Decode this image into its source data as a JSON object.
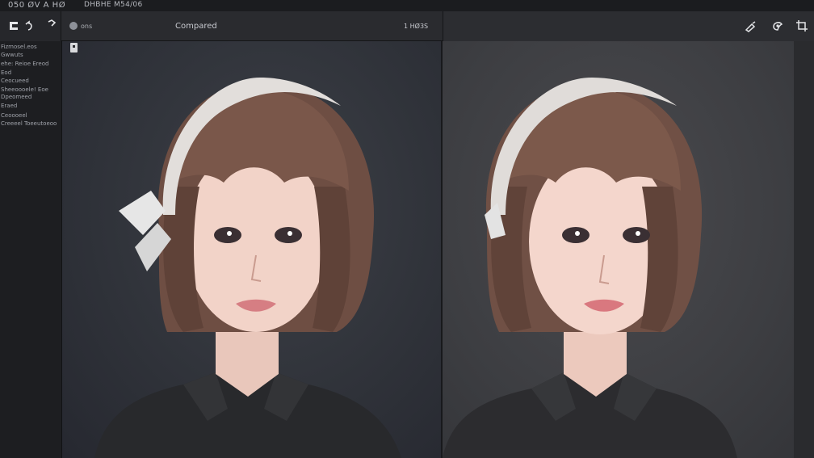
{
  "titlebar": {
    "left_text": "050 ØV A HØ",
    "right_text": "DHBHE M54/06"
  },
  "toolbar": {
    "tab_label": "ons",
    "compare_label": "Compared",
    "zoom_label": "1 HØ3S"
  },
  "sidebar": {
    "items": [
      "Fizmosel.eos",
      "Gwwuts",
      "ehe: Reioe Ereod",
      "Eod",
      "Ceocueed",
      "Sheeoooele! Eoe",
      "Dpeomeed",
      "Eraed",
      "Ceoooeel",
      "Creeeel Toeeutoeoo"
    ]
  },
  "icons": {
    "toolbar_left": [
      "menu-icon",
      "undo-icon"
    ],
    "toolbar_right": [
      "pen-icon",
      "brush-icon",
      "crop-icon"
    ]
  },
  "colors": {
    "background": "#1f2024",
    "toolbar": "#2a2b2f",
    "sidebar": "#1d1e21",
    "accent_text": "#c8cad0"
  }
}
